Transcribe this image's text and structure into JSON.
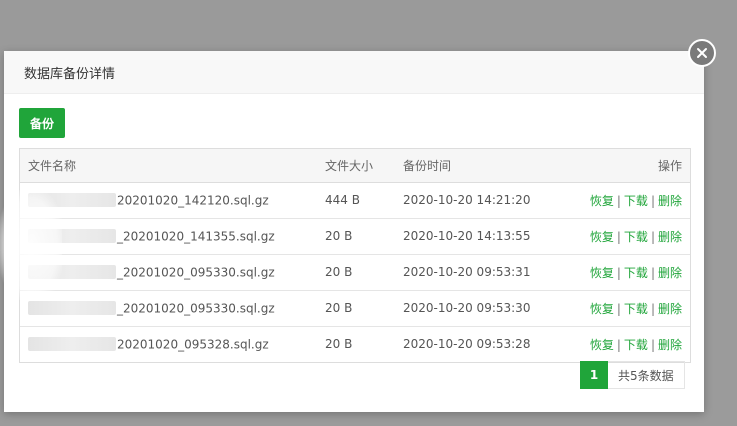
{
  "modal": {
    "title": "数据库备份详情",
    "backup_label": "备份"
  },
  "table": {
    "headers": {
      "name": "文件名称",
      "size": "文件大小",
      "time": "备份时间",
      "ops": "操作"
    },
    "rows": [
      {
        "name": "20201020_142120.sql.gz",
        "size": "444 B",
        "time": "2020-10-20 14:21:20"
      },
      {
        "name": "_20201020_141355.sql.gz",
        "size": "20 B",
        "time": "2020-10-20 14:13:55"
      },
      {
        "name": "_20201020_095330.sql.gz",
        "size": "20 B",
        "time": "2020-10-20 09:53:31"
      },
      {
        "name": "_20201020_095330.sql.gz",
        "size": "20 B",
        "time": "2020-10-20 09:53:30"
      },
      {
        "name": "20201020_095328.sql.gz",
        "size": "20 B",
        "time": "2020-10-20 09:53:28"
      }
    ],
    "actions": {
      "restore": "恢复",
      "download": "下载",
      "delete": "删除",
      "separator": "|"
    }
  },
  "pagination": {
    "current": "1",
    "total_text": "共5条数据"
  },
  "colors": {
    "accent": "#20a53a",
    "overlay": "#9b9b9b"
  }
}
